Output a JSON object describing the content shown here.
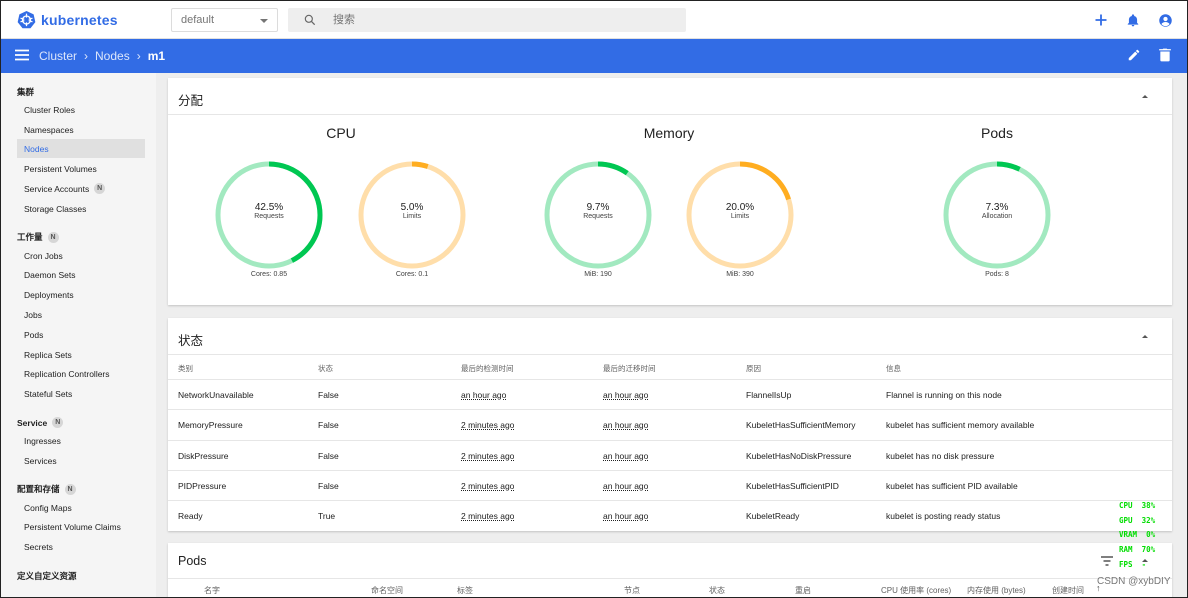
{
  "app": {
    "name": "kubernetes"
  },
  "topbar": {
    "namespace": "default",
    "search_placeholder": "搜索",
    "icons": [
      "add-icon",
      "bell-icon",
      "account-icon"
    ]
  },
  "breadcrumb": {
    "items": [
      "Cluster",
      "Nodes"
    ],
    "current": "m1",
    "icons": [
      "edit-icon",
      "delete-icon"
    ]
  },
  "sidebar": {
    "groups": [
      {
        "title": "集群",
        "badge": "",
        "items": [
          {
            "label": "Cluster Roles",
            "badge": ""
          },
          {
            "label": "Namespaces",
            "badge": ""
          },
          {
            "label": "Nodes",
            "badge": "",
            "active": true
          },
          {
            "label": "Persistent Volumes",
            "badge": ""
          },
          {
            "label": "Service Accounts",
            "badge": "N"
          },
          {
            "label": "Storage Classes",
            "badge": ""
          }
        ]
      },
      {
        "title": "工作量",
        "badge": "N",
        "items": [
          {
            "label": "Cron Jobs",
            "badge": ""
          },
          {
            "label": "Daemon Sets",
            "badge": ""
          },
          {
            "label": "Deployments",
            "badge": ""
          },
          {
            "label": "Jobs",
            "badge": ""
          },
          {
            "label": "Pods",
            "badge": ""
          },
          {
            "label": "Replica Sets",
            "badge": ""
          },
          {
            "label": "Replication Controllers",
            "badge": ""
          },
          {
            "label": "Stateful Sets",
            "badge": ""
          }
        ]
      },
      {
        "title": "Service",
        "badge": "N",
        "items": [
          {
            "label": "Ingresses",
            "badge": ""
          },
          {
            "label": "Services",
            "badge": ""
          }
        ]
      },
      {
        "title": "配置和存储",
        "badge": "N",
        "items": [
          {
            "label": "Config Maps",
            "badge": ""
          },
          {
            "label": "Persistent Volume Claims",
            "badge": ""
          },
          {
            "label": "Secrets",
            "badge": ""
          }
        ]
      },
      {
        "title": "定义自定义资源",
        "badge": "",
        "items": []
      }
    ]
  },
  "allocation": {
    "title": "分配",
    "groups": [
      {
        "title": "CPU",
        "gauges": [
          {
            "percent": 42.5,
            "label": "Requests",
            "footer": "Cores: 0.85",
            "color": "#00c752",
            "track": "#a2e9c0"
          },
          {
            "percent": 5.0,
            "label": "Limits",
            "footer": "Cores: 0.1",
            "color": "#ffad20",
            "track": "#ffdeaa"
          }
        ]
      },
      {
        "title": "Memory",
        "gauges": [
          {
            "percent": 9.7,
            "label": "Requests",
            "footer": "MiB: 190",
            "color": "#00c752",
            "track": "#a2e9c0"
          },
          {
            "percent": 20.0,
            "label": "Limits",
            "footer": "MiB: 390",
            "color": "#ffad20",
            "track": "#ffdeaa"
          }
        ]
      },
      {
        "title": "Pods",
        "gauges": [
          {
            "percent": 7.3,
            "label": "Allocation",
            "footer": "Pods: 8",
            "color": "#00c752",
            "track": "#a2e9c0"
          }
        ]
      }
    ]
  },
  "conditions": {
    "title": "状态",
    "columns": [
      "类别",
      "状态",
      "最后的检测时间",
      "最后的迁移时间",
      "原因",
      "信息"
    ],
    "rows": [
      [
        "NetworkUnavailable",
        "False",
        "an hour ago",
        "an hour ago",
        "FlannelIsUp",
        "Flannel is running on this node"
      ],
      [
        "MemoryPressure",
        "False",
        "2 minutes ago",
        "an hour ago",
        "KubeletHasSufficientMemory",
        "kubelet has sufficient memory available"
      ],
      [
        "DiskPressure",
        "False",
        "2 minutes ago",
        "an hour ago",
        "KubeletHasNoDiskPressure",
        "kubelet has no disk pressure"
      ],
      [
        "PIDPressure",
        "False",
        "2 minutes ago",
        "an hour ago",
        "KubeletHasSufficientPID",
        "kubelet has sufficient PID available"
      ],
      [
        "Ready",
        "True",
        "2 minutes ago",
        "an hour ago",
        "KubeletReady",
        "kubelet is posting ready status"
      ]
    ]
  },
  "pods": {
    "title": "Pods",
    "columns": [
      "名字",
      "命名空间",
      "标签",
      "节点",
      "状态",
      "重启",
      "CPU 使用率 (cores)",
      "内存使用 (bytes)",
      "创建时间"
    ]
  },
  "overlay": {
    "lines": [
      "CPU  38%",
      "GPU  32%",
      "VRAM  0%",
      "RAM  70%",
      "FPS  -"
    ]
  },
  "watermark": "CSDN @xybDIY"
}
